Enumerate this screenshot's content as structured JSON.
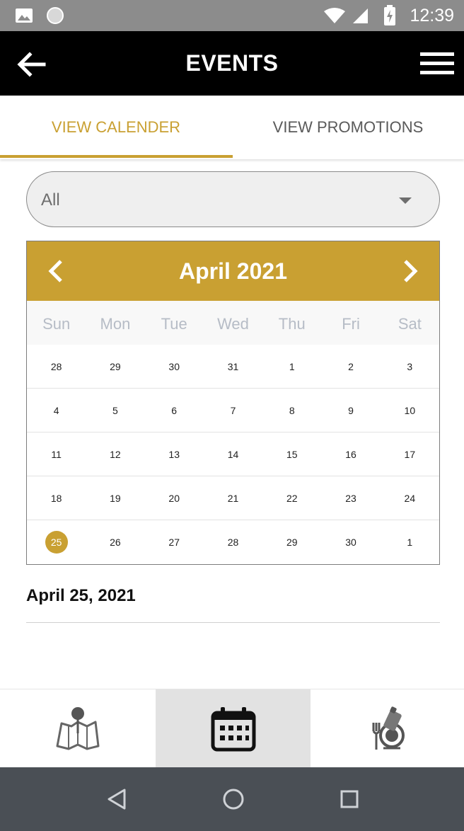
{
  "status_bar": {
    "time": "12:39",
    "icons": [
      "image-icon",
      "circle-notification-icon",
      "wifi-icon",
      "signal-icon",
      "battery-charging-icon"
    ]
  },
  "app_bar": {
    "title": "EVENTS",
    "back_icon": "arrow-left-icon",
    "menu_icon": "hamburger-menu-icon"
  },
  "tabs": [
    {
      "label": "VIEW CALENDER",
      "active": true
    },
    {
      "label": "VIEW PROMOTIONS",
      "active": false
    }
  ],
  "filter": {
    "selected": "All"
  },
  "calendar": {
    "month_label": "April 2021",
    "weekdays": [
      "Sun",
      "Mon",
      "Tue",
      "Wed",
      "Thu",
      "Fri",
      "Sat"
    ],
    "weeks": [
      [
        "28",
        "29",
        "30",
        "31",
        "1",
        "2",
        "3"
      ],
      [
        "4",
        "5",
        "6",
        "7",
        "8",
        "9",
        "10"
      ],
      [
        "11",
        "12",
        "13",
        "14",
        "15",
        "16",
        "17"
      ],
      [
        "18",
        "19",
        "20",
        "21",
        "22",
        "23",
        "24"
      ],
      [
        "25",
        "26",
        "27",
        "28",
        "29",
        "30",
        "1"
      ]
    ],
    "selected_day": "25",
    "accent_color": "#c9a032"
  },
  "selected_date_label": "April 25, 2021",
  "bottom_nav": [
    {
      "icon": "map-pin-icon",
      "active": false
    },
    {
      "icon": "calendar-icon",
      "active": true
    },
    {
      "icon": "dining-icon",
      "active": false
    }
  ],
  "system_nav": [
    "back-triangle-icon",
    "home-circle-icon",
    "recents-square-icon"
  ]
}
